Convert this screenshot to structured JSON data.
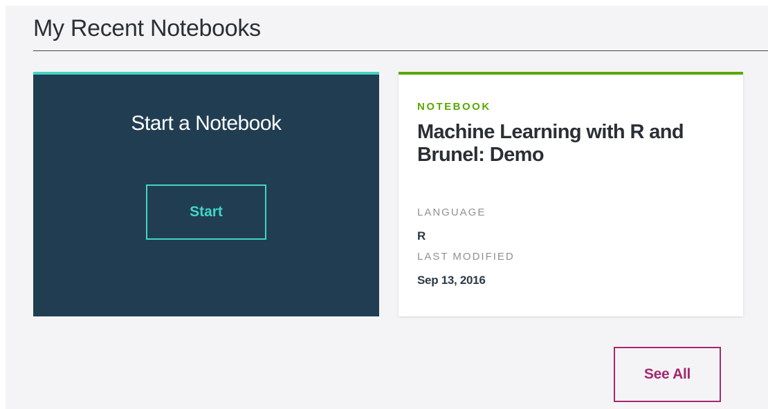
{
  "section": {
    "title": "My Recent Notebooks"
  },
  "start_card": {
    "title": "Start a Notebook",
    "button_label": "Start"
  },
  "notebook_card": {
    "type_label": "NOTEBOOK",
    "title": "Machine Learning with R and Brunel: Demo",
    "language_label": "LANGUAGE",
    "language_value": "R",
    "modified_label": "LAST MODIFIED",
    "modified_value": "Sep 13, 2016"
  },
  "see_all_label": "See All",
  "colors": {
    "start_card_bg": "#213d52",
    "start_accent": "#41d6c3",
    "notebook_accent": "#5aa700",
    "see_all_accent": "#a3286e"
  }
}
